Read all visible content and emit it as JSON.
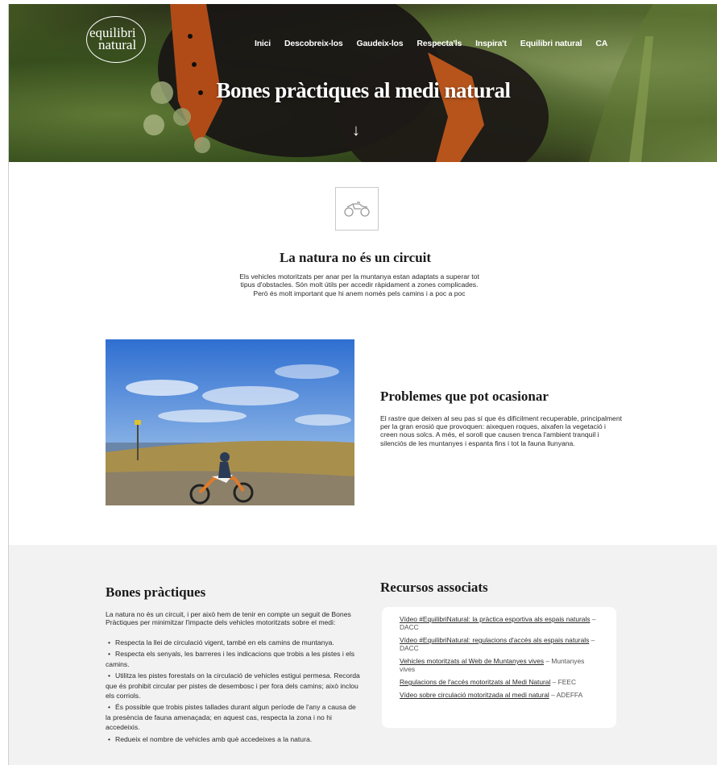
{
  "header": {
    "logo_line1": "equilibri",
    "logo_line2": "natural",
    "nav": [
      "Inici",
      "Descobreix-los",
      "Gaudeix-los",
      "Respecta'ls",
      "Inspira't",
      "Equilibri natural",
      "CA"
    ],
    "title": "Bones pràctiques al medi natural",
    "scroll_arrow": "↓"
  },
  "intro": {
    "icon": "quad-bike-icon",
    "title": "La natura no és un circuit",
    "text": "Els vehicles motoritzats per anar per la muntanya estan adaptats a superar tot tipus d'obstacles. Són molt útils per accedir ràpidament a zones complicades. Però és molt important que hi anem només pels camins i a poc a poc"
  },
  "problems": {
    "title": "Problemes que pot ocasionar",
    "text": "El rastre que deixen al seu pas sí que és difícilment recuperable, principalment per la gran erosió que provoquen: aixequen roques, aixafen la vegetació i creen nous solcs. A més, el soroll que causen trenca l'ambient tranquil i silenciós de les muntanyes i espanta fins i tot la fauna llunyana."
  },
  "practices": {
    "title": "Bones pràctiques",
    "intro": "La natura no és un circuit, i per això hem de tenir en compte un seguit de Bones Pràctiques per minimitzar l'impacte dels vehicles motoritzats sobre el medi:",
    "items": [
      "Respecta la llei de circulació vigent, també en els camins de muntanya.",
      "Respecta els senyals, les barreres i les indicacions que trobis a les pistes i els camins.",
      "Utilitza les pistes forestals on la circulació de vehicles estigui permesa. Recorda que és prohibit circular per pistes de desembosc i per fora dels camins; això inclou els corriols.",
      "És possible que trobis pistes tallades durant algun període de l'any a causa de la presència de fauna amenaçada; en aquest cas, respecta la zona i no hi accedeixis.",
      "Redueix el nombre de vehicles amb què accedeixes a la natura."
    ],
    "bullet": "•"
  },
  "resources": {
    "title": "Recursos associats",
    "items": [
      {
        "link": "Vídeo #EquilibriNatural: la pràctica esportiva als espais naturals",
        "source": " – DACC"
      },
      {
        "link": "Vídeo #EquilibriNatural: regulacions d'accés als espais naturals",
        "source": " – DACC"
      },
      {
        "link": "Vehicles motoritzats al Web de Muntanyes vives",
        "source": " – Muntanyes vives"
      },
      {
        "link": "Regulacions de l'accés motoritzats al Medi Natural",
        "source": " – FEEC"
      },
      {
        "link": "Vídeo sobre circulació motoritzada al medi natural",
        "source": " – ADEFFA"
      }
    ]
  }
}
